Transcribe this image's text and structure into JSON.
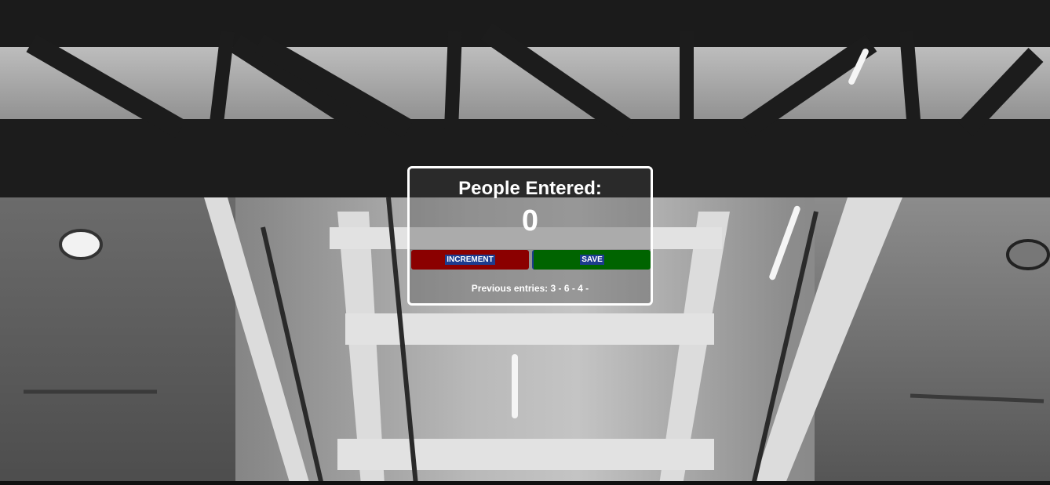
{
  "counter": {
    "title": "People Entered:",
    "count": "0",
    "increment_label": "INCREMENT",
    "save_label": "SAVE",
    "previous_entries": "Previous entries: 3 - 6 - 4 -"
  },
  "colors": {
    "increment_bg": "#8b0000",
    "save_bg": "#006400",
    "border": "#ffffff"
  }
}
